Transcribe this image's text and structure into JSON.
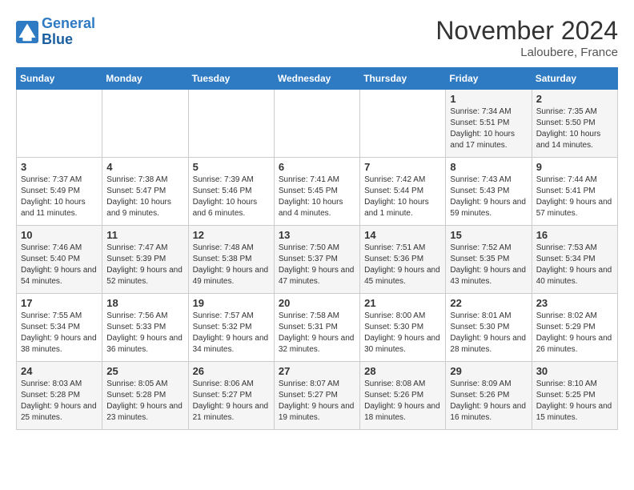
{
  "logo": {
    "line1": "General",
    "line2": "Blue"
  },
  "title": "November 2024",
  "location": "Laloubere, France",
  "days_of_week": [
    "Sunday",
    "Monday",
    "Tuesday",
    "Wednesday",
    "Thursday",
    "Friday",
    "Saturday"
  ],
  "weeks": [
    [
      {
        "day": "",
        "info": ""
      },
      {
        "day": "",
        "info": ""
      },
      {
        "day": "",
        "info": ""
      },
      {
        "day": "",
        "info": ""
      },
      {
        "day": "",
        "info": ""
      },
      {
        "day": "1",
        "info": "Sunrise: 7:34 AM\nSunset: 5:51 PM\nDaylight: 10 hours and 17 minutes."
      },
      {
        "day": "2",
        "info": "Sunrise: 7:35 AM\nSunset: 5:50 PM\nDaylight: 10 hours and 14 minutes."
      }
    ],
    [
      {
        "day": "3",
        "info": "Sunrise: 7:37 AM\nSunset: 5:49 PM\nDaylight: 10 hours and 11 minutes."
      },
      {
        "day": "4",
        "info": "Sunrise: 7:38 AM\nSunset: 5:47 PM\nDaylight: 10 hours and 9 minutes."
      },
      {
        "day": "5",
        "info": "Sunrise: 7:39 AM\nSunset: 5:46 PM\nDaylight: 10 hours and 6 minutes."
      },
      {
        "day": "6",
        "info": "Sunrise: 7:41 AM\nSunset: 5:45 PM\nDaylight: 10 hours and 4 minutes."
      },
      {
        "day": "7",
        "info": "Sunrise: 7:42 AM\nSunset: 5:44 PM\nDaylight: 10 hours and 1 minute."
      },
      {
        "day": "8",
        "info": "Sunrise: 7:43 AM\nSunset: 5:43 PM\nDaylight: 9 hours and 59 minutes."
      },
      {
        "day": "9",
        "info": "Sunrise: 7:44 AM\nSunset: 5:41 PM\nDaylight: 9 hours and 57 minutes."
      }
    ],
    [
      {
        "day": "10",
        "info": "Sunrise: 7:46 AM\nSunset: 5:40 PM\nDaylight: 9 hours and 54 minutes."
      },
      {
        "day": "11",
        "info": "Sunrise: 7:47 AM\nSunset: 5:39 PM\nDaylight: 9 hours and 52 minutes."
      },
      {
        "day": "12",
        "info": "Sunrise: 7:48 AM\nSunset: 5:38 PM\nDaylight: 9 hours and 49 minutes."
      },
      {
        "day": "13",
        "info": "Sunrise: 7:50 AM\nSunset: 5:37 PM\nDaylight: 9 hours and 47 minutes."
      },
      {
        "day": "14",
        "info": "Sunrise: 7:51 AM\nSunset: 5:36 PM\nDaylight: 9 hours and 45 minutes."
      },
      {
        "day": "15",
        "info": "Sunrise: 7:52 AM\nSunset: 5:35 PM\nDaylight: 9 hours and 43 minutes."
      },
      {
        "day": "16",
        "info": "Sunrise: 7:53 AM\nSunset: 5:34 PM\nDaylight: 9 hours and 40 minutes."
      }
    ],
    [
      {
        "day": "17",
        "info": "Sunrise: 7:55 AM\nSunset: 5:34 PM\nDaylight: 9 hours and 38 minutes."
      },
      {
        "day": "18",
        "info": "Sunrise: 7:56 AM\nSunset: 5:33 PM\nDaylight: 9 hours and 36 minutes."
      },
      {
        "day": "19",
        "info": "Sunrise: 7:57 AM\nSunset: 5:32 PM\nDaylight: 9 hours and 34 minutes."
      },
      {
        "day": "20",
        "info": "Sunrise: 7:58 AM\nSunset: 5:31 PM\nDaylight: 9 hours and 32 minutes."
      },
      {
        "day": "21",
        "info": "Sunrise: 8:00 AM\nSunset: 5:30 PM\nDaylight: 9 hours and 30 minutes."
      },
      {
        "day": "22",
        "info": "Sunrise: 8:01 AM\nSunset: 5:30 PM\nDaylight: 9 hours and 28 minutes."
      },
      {
        "day": "23",
        "info": "Sunrise: 8:02 AM\nSunset: 5:29 PM\nDaylight: 9 hours and 26 minutes."
      }
    ],
    [
      {
        "day": "24",
        "info": "Sunrise: 8:03 AM\nSunset: 5:28 PM\nDaylight: 9 hours and 25 minutes."
      },
      {
        "day": "25",
        "info": "Sunrise: 8:05 AM\nSunset: 5:28 PM\nDaylight: 9 hours and 23 minutes."
      },
      {
        "day": "26",
        "info": "Sunrise: 8:06 AM\nSunset: 5:27 PM\nDaylight: 9 hours and 21 minutes."
      },
      {
        "day": "27",
        "info": "Sunrise: 8:07 AM\nSunset: 5:27 PM\nDaylight: 9 hours and 19 minutes."
      },
      {
        "day": "28",
        "info": "Sunrise: 8:08 AM\nSunset: 5:26 PM\nDaylight: 9 hours and 18 minutes."
      },
      {
        "day": "29",
        "info": "Sunrise: 8:09 AM\nSunset: 5:26 PM\nDaylight: 9 hours and 16 minutes."
      },
      {
        "day": "30",
        "info": "Sunrise: 8:10 AM\nSunset: 5:25 PM\nDaylight: 9 hours and 15 minutes."
      }
    ]
  ]
}
